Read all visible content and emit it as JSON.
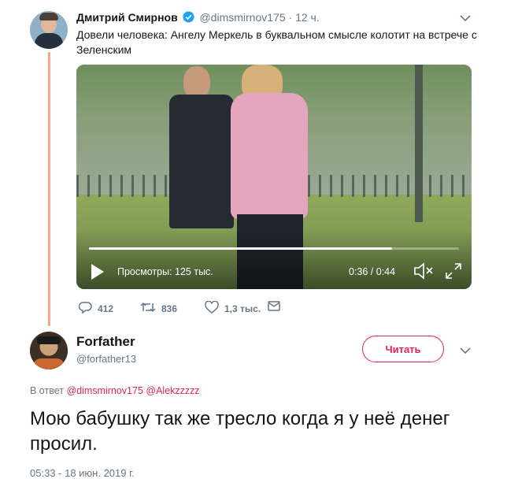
{
  "tweet1": {
    "author_name": "Дмитрий Смирнов",
    "author_handle": "@dimsmirnov175",
    "separator": "·",
    "time_ago": "12 ч.",
    "text": "Довели человека: Ангелу Меркель в буквальном смысле колотит на встрече с Зеленским",
    "video": {
      "views_label": "Просмотры: 125 тыс.",
      "time_display": "0:36 / 0:44",
      "progress": 0.82
    },
    "actions": {
      "replies": "412",
      "retweets": "836",
      "likes": "1,3 тыс."
    }
  },
  "tweet2": {
    "author_name": "Forfather",
    "author_handle": "@forfather13",
    "follow_label": "Читать",
    "reply_prefix": "В ответ",
    "reply_mentions": [
      "@dimsmirnov175",
      "@Alekzzzzz"
    ],
    "text": "Мою бабушку так же тресло когда я у неё денег просил.",
    "timestamp": "05:33 - 18 июн. 2019 г."
  },
  "colors": {
    "accent": "#e0245e",
    "muted": "#657786",
    "verified": "#1da1f2",
    "thread_line": "#f8a48f"
  },
  "icons": [
    "verified-badge-icon",
    "chevron-down-icon",
    "play-icon",
    "volume-mute-icon",
    "fullscreen-icon",
    "reply-icon",
    "retweet-icon",
    "like-icon",
    "direct-message-icon"
  ]
}
